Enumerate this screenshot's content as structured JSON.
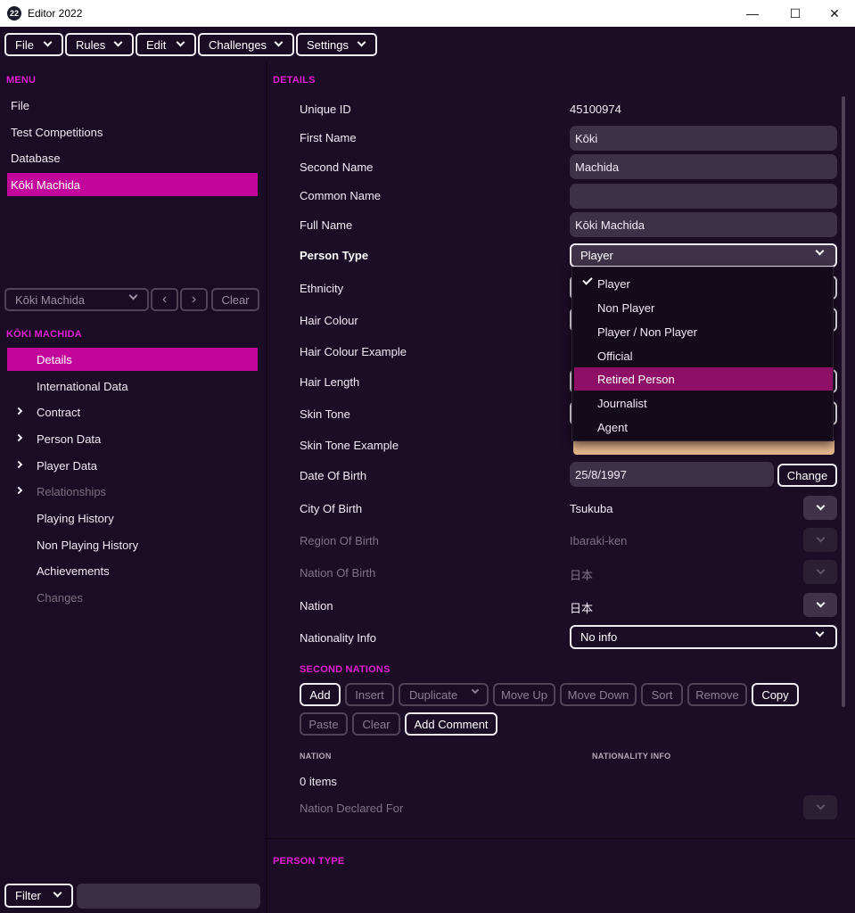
{
  "window": {
    "logo": "22",
    "title": "Editor 2022",
    "minimize": "—",
    "maximize": "☐",
    "close": "✕"
  },
  "menubar": [
    "File",
    "Rules",
    "Edit",
    "Challenges",
    "Settings"
  ],
  "sidebar": {
    "menu_heading": "MENU",
    "menu_items": [
      "File",
      "Test Competitions",
      "Database",
      "Kōki Machida"
    ],
    "nav": {
      "selector": "Kōki Machida",
      "prev": "‹",
      "next": "›",
      "clear": "Clear"
    },
    "person_heading": "KŌKI MACHIDA",
    "person_items": [
      "Details",
      "International Data",
      "Contract",
      "Person Data",
      "Player Data",
      "Relationships",
      "Playing History",
      "Non Playing History",
      "Achievements",
      "Changes"
    ],
    "filter_label": "Filter"
  },
  "details": {
    "heading": "DETAILS",
    "unique_id_label": "Unique ID",
    "unique_id": "45100974",
    "first_name_label": "First Name",
    "first_name": "Kōki",
    "second_name_label": "Second Name",
    "second_name": "Machida",
    "common_name_label": "Common Name",
    "common_name": "",
    "full_name_label": "Full Name",
    "full_name": "Kōki Machida",
    "person_type_label": "Person Type",
    "person_type": "Player",
    "ethnicity_label": "Ethnicity",
    "hair_colour_label": "Hair Colour",
    "hair_colour_example_label": "Hair Colour Example",
    "hair_length_label": "Hair Length",
    "skin_tone_label": "Skin Tone",
    "skin_tone_example_label": "Skin Tone Example",
    "skin_tone_color": "#e4b68c",
    "dob_label": "Date Of Birth",
    "dob": "25/8/1997",
    "change_label": "Change",
    "city_label": "City Of Birth",
    "city": "Tsukuba",
    "region_label": "Region Of Birth",
    "region": "Ibaraki-ken",
    "nation_of_birth_label": "Nation Of Birth",
    "nation_of_birth": "日本",
    "nation_label": "Nation",
    "nation": "日本",
    "nationality_info_label": "Nationality Info",
    "nationality_info": "No info"
  },
  "person_type_options": [
    "Player",
    "Non Player",
    "Player / Non Player",
    "Official",
    "Retired Person",
    "Journalist",
    "Agent"
  ],
  "second_nations": {
    "heading": "SECOND NATIONS",
    "buttons": [
      "Add",
      "Insert",
      "Duplicate",
      "Move Up",
      "Move Down",
      "Sort",
      "Remove",
      "Copy",
      "Paste",
      "Clear",
      "Add Comment"
    ],
    "col_nation": "NATION",
    "col_nationality_info": "NATIONALITY INFO",
    "items_count": "0 items",
    "nation_declared_label": "Nation Declared For"
  },
  "bottom_heading": "PERSON TYPE",
  "colors": {
    "accent": "#e21fd0",
    "active_bg": "#c2069c",
    "highlight": "#8e1066",
    "background": "#1b0c26"
  }
}
